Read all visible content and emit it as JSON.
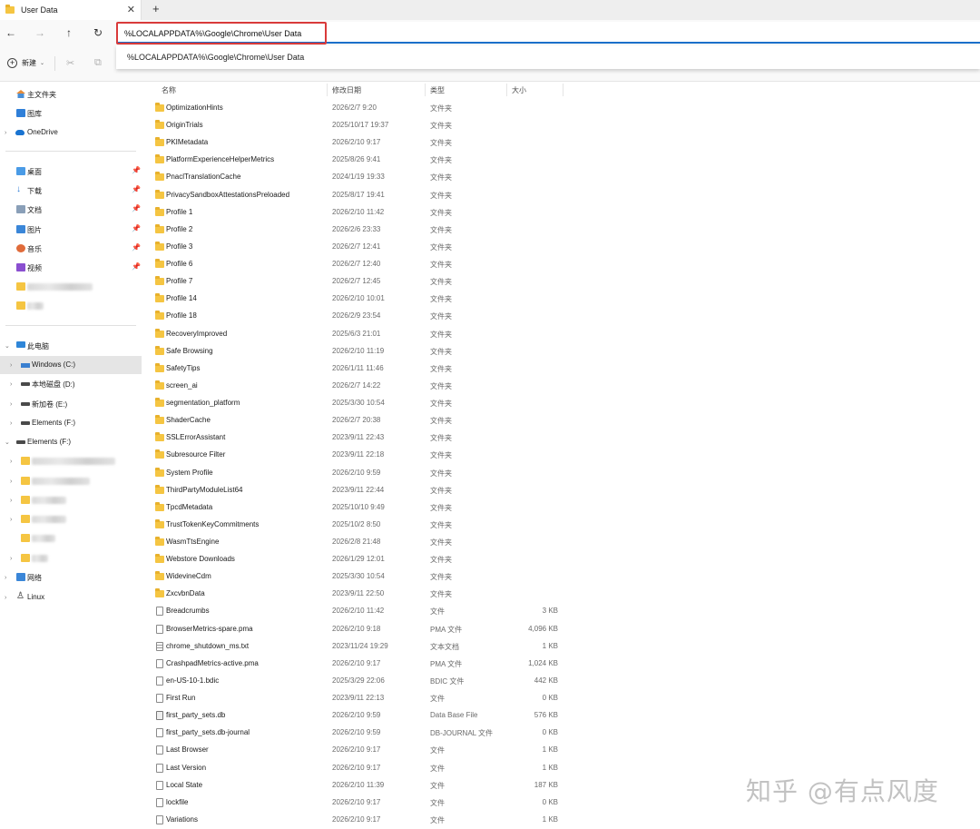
{
  "tab": {
    "title": "User Data",
    "close": "✕",
    "new_tab": "+"
  },
  "nav": {
    "back": "←",
    "forward": "→",
    "up": "↑",
    "refresh": "↻"
  },
  "address": {
    "value": "%LOCALAPPDATA%\\Google\\Chrome\\User Data",
    "suggestion": "%LOCALAPPDATA%\\Google\\Chrome\\User Data"
  },
  "toolbar": {
    "new_label": "新建",
    "new_icon": "+",
    "caret": "⌄",
    "cut_icon": "✂",
    "copy_icon": "⧉"
  },
  "sidebar": {
    "pin": "📌",
    "quick": [
      {
        "label": "主文件夹",
        "icon": "home-icon"
      },
      {
        "label": "图库",
        "icon": "gallery-icon"
      },
      {
        "label": "OneDrive",
        "icon": "onedrive-icon"
      }
    ],
    "pinned": [
      {
        "label": "桌面",
        "icon": "desktop-icon"
      },
      {
        "label": "下载",
        "icon": "download-icon"
      },
      {
        "label": "文档",
        "icon": "documents-icon"
      },
      {
        "label": "图片",
        "icon": "pictures-icon"
      },
      {
        "label": "音乐",
        "icon": "music-icon"
      },
      {
        "label": "视频",
        "icon": "videos-icon"
      }
    ],
    "this_pc": "此电脑",
    "drives": [
      {
        "label": "Windows (C:)"
      },
      {
        "label": "本地磁盘 (D:)"
      },
      {
        "label": "新加卷 (E:)"
      },
      {
        "label": "Elements (F:)"
      }
    ],
    "elements_root": "Elements (F:)",
    "network": "网络",
    "linux": "Linux"
  },
  "columns": {
    "name": "名称",
    "date": "修改日期",
    "type": "类型",
    "size": "大小"
  },
  "files": [
    {
      "name": "OptimizationHints",
      "date": "2026/2/7 9:20",
      "type": "文件夹",
      "size": "",
      "kind": "folder"
    },
    {
      "name": "OriginTrials",
      "date": "2025/10/17 19:37",
      "type": "文件夹",
      "size": "",
      "kind": "folder"
    },
    {
      "name": "PKIMetadata",
      "date": "2026/2/10 9:17",
      "type": "文件夹",
      "size": "",
      "kind": "folder"
    },
    {
      "name": "PlatformExperienceHelperMetrics",
      "date": "2025/8/26 9:41",
      "type": "文件夹",
      "size": "",
      "kind": "folder"
    },
    {
      "name": "PnaclTranslationCache",
      "date": "2024/1/19 19:33",
      "type": "文件夹",
      "size": "",
      "kind": "folder"
    },
    {
      "name": "PrivacySandboxAttestationsPreloaded",
      "date": "2025/8/17 19:41",
      "type": "文件夹",
      "size": "",
      "kind": "folder"
    },
    {
      "name": "Profile 1",
      "date": "2026/2/10 11:42",
      "type": "文件夹",
      "size": "",
      "kind": "folder"
    },
    {
      "name": "Profile 2",
      "date": "2026/2/6 23:33",
      "type": "文件夹",
      "size": "",
      "kind": "folder"
    },
    {
      "name": "Profile 3",
      "date": "2026/2/7 12:41",
      "type": "文件夹",
      "size": "",
      "kind": "folder"
    },
    {
      "name": "Profile 6",
      "date": "2026/2/7 12:40",
      "type": "文件夹",
      "size": "",
      "kind": "folder"
    },
    {
      "name": "Profile 7",
      "date": "2026/2/7 12:45",
      "type": "文件夹",
      "size": "",
      "kind": "folder"
    },
    {
      "name": "Profile 14",
      "date": "2026/2/10 10:01",
      "type": "文件夹",
      "size": "",
      "kind": "folder"
    },
    {
      "name": "Profile 18",
      "date": "2026/2/9 23:54",
      "type": "文件夹",
      "size": "",
      "kind": "folder"
    },
    {
      "name": "RecoveryImproved",
      "date": "2025/6/3 21:01",
      "type": "文件夹",
      "size": "",
      "kind": "folder"
    },
    {
      "name": "Safe Browsing",
      "date": "2026/2/10 11:19",
      "type": "文件夹",
      "size": "",
      "kind": "folder"
    },
    {
      "name": "SafetyTips",
      "date": "2026/1/11 11:46",
      "type": "文件夹",
      "size": "",
      "kind": "folder"
    },
    {
      "name": "screen_ai",
      "date": "2026/2/7 14:22",
      "type": "文件夹",
      "size": "",
      "kind": "folder"
    },
    {
      "name": "segmentation_platform",
      "date": "2025/3/30 10:54",
      "type": "文件夹",
      "size": "",
      "kind": "folder"
    },
    {
      "name": "ShaderCache",
      "date": "2026/2/7 20:38",
      "type": "文件夹",
      "size": "",
      "kind": "folder"
    },
    {
      "name": "SSLErrorAssistant",
      "date": "2023/9/11 22:43",
      "type": "文件夹",
      "size": "",
      "kind": "folder"
    },
    {
      "name": "Subresource Filter",
      "date": "2023/9/11 22:18",
      "type": "文件夹",
      "size": "",
      "kind": "folder"
    },
    {
      "name": "System Profile",
      "date": "2026/2/10 9:59",
      "type": "文件夹",
      "size": "",
      "kind": "folder"
    },
    {
      "name": "ThirdPartyModuleList64",
      "date": "2023/9/11 22:44",
      "type": "文件夹",
      "size": "",
      "kind": "folder"
    },
    {
      "name": "TpcdMetadata",
      "date": "2025/10/10 9:49",
      "type": "文件夹",
      "size": "",
      "kind": "folder"
    },
    {
      "name": "TrustTokenKeyCommitments",
      "date": "2025/10/2 8:50",
      "type": "文件夹",
      "size": "",
      "kind": "folder"
    },
    {
      "name": "WasmTtsEngine",
      "date": "2026/2/8 21:48",
      "type": "文件夹",
      "size": "",
      "kind": "folder"
    },
    {
      "name": "Webstore Downloads",
      "date": "2026/1/29 12:01",
      "type": "文件夹",
      "size": "",
      "kind": "folder"
    },
    {
      "name": "WidevineCdm",
      "date": "2025/3/30 10:54",
      "type": "文件夹",
      "size": "",
      "kind": "folder"
    },
    {
      "name": "ZxcvbnData",
      "date": "2023/9/11 22:50",
      "type": "文件夹",
      "size": "",
      "kind": "folder"
    },
    {
      "name": "Breadcrumbs",
      "date": "2026/2/10 11:42",
      "type": "文件",
      "size": "3 KB",
      "kind": "file"
    },
    {
      "name": "BrowserMetrics-spare.pma",
      "date": "2026/2/10 9:18",
      "type": "PMA 文件",
      "size": "4,096 KB",
      "kind": "file"
    },
    {
      "name": "chrome_shutdown_ms.txt",
      "date": "2023/11/24 19:29",
      "type": "文本文档",
      "size": "1 KB",
      "kind": "txt"
    },
    {
      "name": "CrashpadMetrics-active.pma",
      "date": "2026/2/10 9:17",
      "type": "PMA 文件",
      "size": "1,024 KB",
      "kind": "file"
    },
    {
      "name": "en-US-10-1.bdic",
      "date": "2025/3/29 22:06",
      "type": "BDIC 文件",
      "size": "442 KB",
      "kind": "file"
    },
    {
      "name": "First Run",
      "date": "2023/9/11 22:13",
      "type": "文件",
      "size": "0 KB",
      "kind": "file"
    },
    {
      "name": "first_party_sets.db",
      "date": "2026/2/10 9:59",
      "type": "Data Base File",
      "size": "576 KB",
      "kind": "db"
    },
    {
      "name": "first_party_sets.db-journal",
      "date": "2026/2/10 9:59",
      "type": "DB-JOURNAL 文件",
      "size": "0 KB",
      "kind": "file"
    },
    {
      "name": "Last Browser",
      "date": "2026/2/10 9:17",
      "type": "文件",
      "size": "1 KB",
      "kind": "file"
    },
    {
      "name": "Last Version",
      "date": "2026/2/10 9:17",
      "type": "文件",
      "size": "1 KB",
      "kind": "file"
    },
    {
      "name": "Local State",
      "date": "2026/2/10 11:39",
      "type": "文件",
      "size": "187 KB",
      "kind": "file"
    },
    {
      "name": "lockfile",
      "date": "2026/2/10 9:17",
      "type": "文件",
      "size": "0 KB",
      "kind": "file"
    },
    {
      "name": "Variations",
      "date": "2026/2/10 9:17",
      "type": "文件",
      "size": "1 KB",
      "kind": "file"
    }
  ],
  "watermark": "知乎 @有点风度",
  "colors": {
    "accent": "#1a6fc9",
    "highlight_border": "#d93a3a",
    "folder": "#f5c542",
    "selected_bg": "#e5e5e5"
  }
}
